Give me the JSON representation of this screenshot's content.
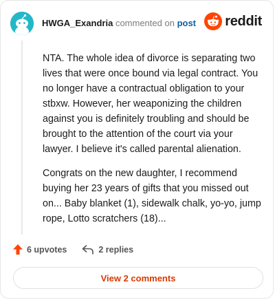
{
  "comment": {
    "username": "HWGA_Exandria",
    "commented_on_text": "commented on",
    "post_link": "post",
    "paragraphs": [
      "NTA. The whole idea of divorce is separating two lives that were once bound via legal contract. You no longer have a contractual obligation to your stbxw. However, her weaponizing the children against you is definitely troubling and should be brought to the attention of the court via your lawyer. I believe it's called parental alienation.",
      "Congrats on the new daughter, I recommend buying her 23 years of gifts that you missed out on... Baby blanket (1), sidewalk chalk, yo-yo, jump rope, Lotto scratchers (18)..."
    ]
  },
  "logo": {
    "text": "reddit",
    "icon": "reddit-snoo-icon"
  },
  "actions": {
    "upvotes_label": "6 upvotes",
    "upvote_icon": "upvote-arrow-icon",
    "replies_label": "2 replies",
    "reply_icon": "reply-arrow-icon"
  },
  "view_comments_label": "View 2 comments",
  "colors": {
    "brand_orange": "#ff4500",
    "upvote_orange": "#ff4500",
    "avatar_bg": "#22b8c7",
    "link_blue": "#0b5fa6",
    "view_comments_text": "#d93a00"
  }
}
